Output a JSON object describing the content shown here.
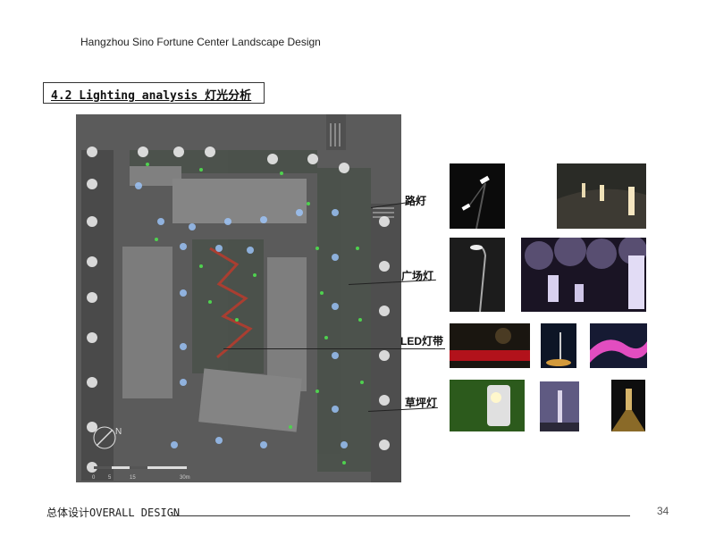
{
  "header": {
    "project_title": "Hangzhou Sino Fortune Center Landscape Design"
  },
  "section": {
    "title": "4.2 Lighting analysis 灯光分析"
  },
  "callouts": [
    {
      "label": "路灯"
    },
    {
      "label": "广场灯"
    },
    {
      "label": "LED灯带"
    },
    {
      "label": "草坪灯"
    }
  ],
  "scale_bar": {
    "ticks": [
      "0",
      "5",
      "15",
      "30m"
    ],
    "north": "N"
  },
  "footer": {
    "section_label": "总体设计OVERALL DESIGN",
    "page_number": "34"
  },
  "colors": {
    "plan_bg": "#5a5a5a",
    "building": "#7a7a7a",
    "light_green": "#4fd14f",
    "light_blue": "#9ec8ff",
    "street_lamp": "#f2f2f2",
    "led_strip": "#c0392b"
  }
}
